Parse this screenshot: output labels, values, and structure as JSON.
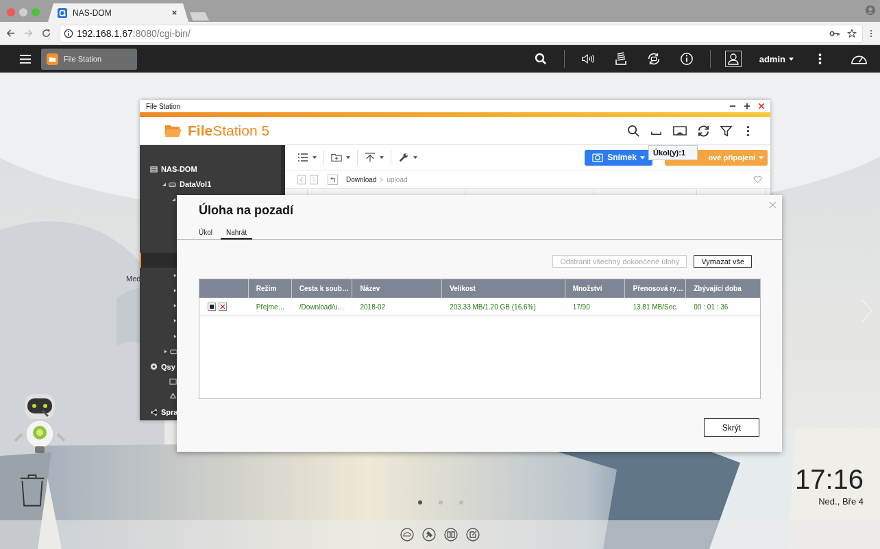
{
  "browser": {
    "tab_title": "NAS-DOM",
    "url_host": "192.168.1.67",
    "url_path": ":8080/cgi-bin/"
  },
  "top_bar": {
    "app_tab": "File Station",
    "user": "admin"
  },
  "file_station": {
    "title": "File Station",
    "logo_bold": "File",
    "logo_rest": "Station 5",
    "tooltip": "Úkol(y):1",
    "snapshot_button": "Snímek",
    "connect_button": "ové připojení",
    "breadcrumb": [
      {
        "label": "Download",
        "current": false
      },
      {
        "label": "upload",
        "current": true
      }
    ],
    "tree": [
      {
        "label": "NAS-DOM",
        "children": [
          {
            "label": "DataVol1"
          }
        ]
      },
      {
        "label": "Qsy"
      },
      {
        "label": "Spra"
      }
    ]
  },
  "dialog": {
    "title": "Úloha na pozadí",
    "tabs": [
      {
        "label": "Úkol",
        "selected": false
      },
      {
        "label": "Nahrát",
        "selected": true
      }
    ],
    "actions": [
      {
        "label": "Odstranit všechny dokončené úlohy",
        "disabled": true
      },
      {
        "label": "Vymazat vše",
        "disabled": false
      }
    ],
    "columns": [
      "Režim",
      "Cesta k soub…",
      "Název",
      "Velikost",
      "Množství",
      "Přenosová ry…",
      "Zbývající doba"
    ],
    "rows": [
      {
        "cells": [
          "Přejme…",
          "/Download/u…",
          "2018-02",
          "203.33 MB/1.20 GB (16.6%)",
          "17/90",
          "13.81 MB/Sec.",
          "00 : 01 : 36"
        ]
      }
    ],
    "hide_button": "Skrýt"
  },
  "desktop": {
    "icon_label": "Med",
    "clock": "17:16",
    "date": "Ned., Bře 4",
    "pages": [
      {
        "selected": true
      },
      {
        "selected": false
      },
      {
        "selected": false
      }
    ]
  }
}
